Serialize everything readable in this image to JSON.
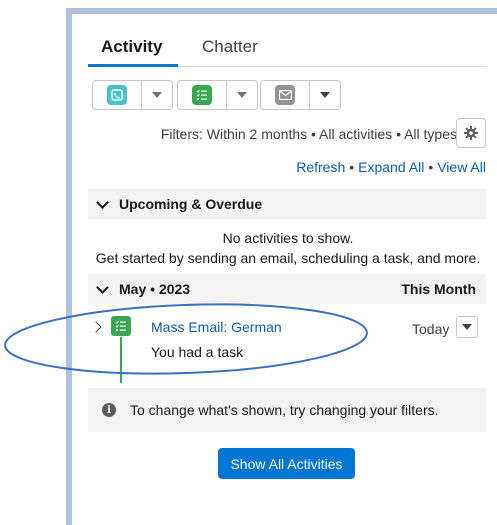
{
  "tabs": [
    {
      "label": "Activity",
      "active": true
    },
    {
      "label": "Chatter",
      "active": false
    }
  ],
  "actions": [
    {
      "icon": "log-call-icon",
      "color": "#48c3cc"
    },
    {
      "icon": "new-task-icon",
      "color": "#3ba755"
    },
    {
      "icon": "email-icon",
      "color": "#939393"
    }
  ],
  "filters": {
    "text": "Filters: Within 2 months • All activities • All types"
  },
  "links": {
    "refresh": "Refresh",
    "expand_all": "Expand All",
    "view_all": "View All",
    "separator": "•"
  },
  "upcoming": {
    "title": "Upcoming & Overdue",
    "empty_line1": "No activities to show.",
    "empty_line2": "Get started by sending an email, scheduling a task, and more."
  },
  "month_section": {
    "title": "May • 2023",
    "right_label": "This Month"
  },
  "item": {
    "title": "Mass Email: German",
    "subtitle": "You had a task",
    "date": "Today"
  },
  "info": {
    "text": "To change what's shown, try changing your filters."
  },
  "show_all_button": "Show All Activities",
  "colors": {
    "brand": "#0176d3",
    "link": "#0b5cab",
    "task_green": "#3ba755",
    "annotation": "#3a6fc4"
  }
}
